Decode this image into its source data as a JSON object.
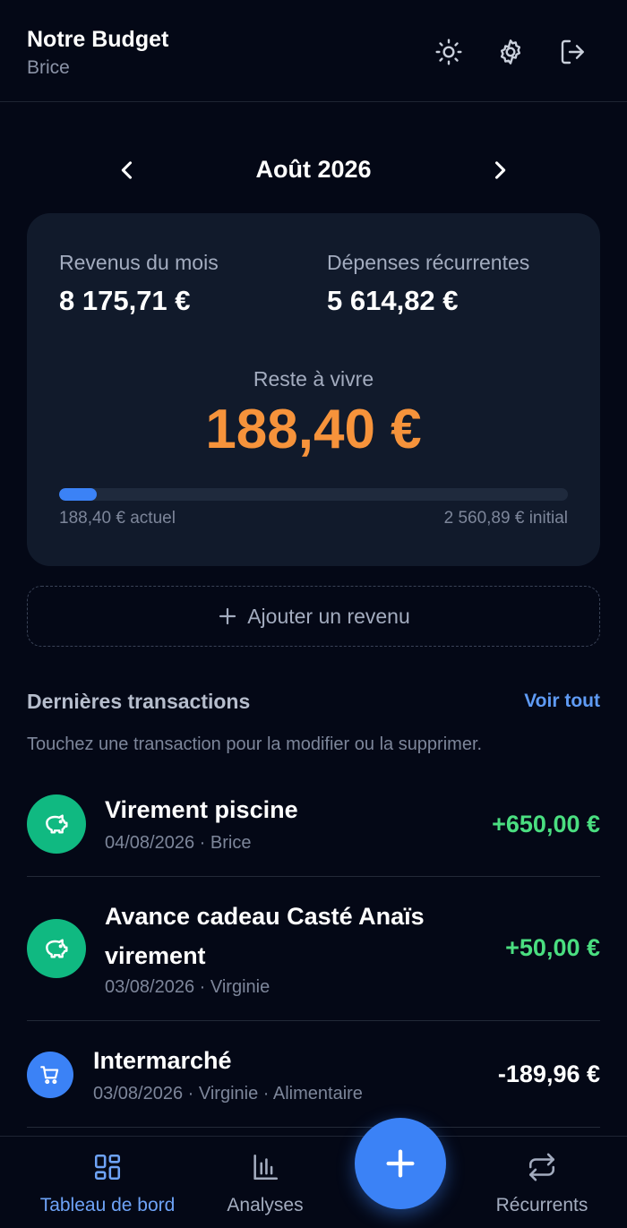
{
  "header": {
    "title": "Notre Budget",
    "user": "Brice",
    "icons": [
      "sun-icon",
      "gear-icon",
      "logout-icon"
    ]
  },
  "month_nav": {
    "label": "Août 2026"
  },
  "summary": {
    "income_label": "Revenus du mois",
    "income_value": "8 175,71 €",
    "recurring_label": "Dépenses récurrentes",
    "recurring_value": "5 614,82 €",
    "remaining_label": "Reste à vivre",
    "remaining_value": "188,40 €",
    "progress_fraction": 0.0736,
    "progress_current": "188,40 € actuel",
    "progress_initial": "2 560,89 € initial"
  },
  "add_income_label": "Ajouter un revenu",
  "transactions": {
    "title": "Dernières transactions",
    "see_all": "Voir tout",
    "hint": "Touchez une transaction pour la modifier ou la supprimer.",
    "items": [
      {
        "title": "Virement piscine",
        "meta": "04/08/2026 · Brice",
        "amount": "+650,00 €",
        "icon": "piggy-bank-icon"
      },
      {
        "title_line1": "Avance cadeau Casté Anaïs",
        "title_line2": "virement",
        "meta": "03/08/2026 · Virginie",
        "amount": "+50,00 €",
        "icon": "piggy-bank-icon"
      },
      {
        "title": "Intermarché",
        "meta": "03/08/2026 · Virginie · Alimentaire",
        "amount": "-189,96 €",
        "icon": "cart-icon"
      }
    ]
  },
  "colors": {
    "background": "#040816",
    "card": "#111a2b",
    "accent": "#3b82f6",
    "remaining": "#f6933b",
    "income_green": "#4ade80",
    "income_icon_bg": "#10b981"
  },
  "bottom_nav": {
    "dashboard": "Tableau de bord",
    "analytics": "Analyses",
    "recurring": "Récurrents"
  }
}
